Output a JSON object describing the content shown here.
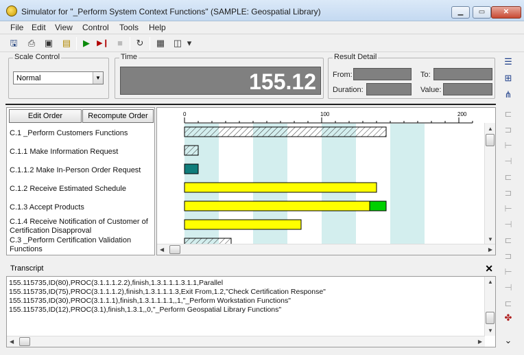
{
  "window": {
    "title": "Simulator for \"_Perform System Context Functions\" (SAMPLE: Geospatial Library)",
    "buttons": {
      "minimize": "▁",
      "maximize": "▭",
      "close": "✕"
    }
  },
  "menu": [
    "File",
    "Edit",
    "View",
    "Control",
    "Tools",
    "Help"
  ],
  "toolbar": {
    "icons": [
      "save-icon",
      "print-icon",
      "print-preview-icon",
      "export-icon",
      "play-icon",
      "step-icon",
      "stop-icon",
      "reset-icon",
      "grid-icon",
      "layout-icon",
      "dropdown-icon"
    ],
    "glyphs": {
      "save": "🖫",
      "print": "⎙",
      "preview": "▣",
      "export": "▤",
      "play": "▶",
      "step": "▶❙",
      "stop": "■",
      "reset": "↻",
      "grid": "▦",
      "layout": "◫",
      "dropdown": "▾"
    }
  },
  "scale_control": {
    "title": "Scale Control",
    "value": "Normal",
    "arrow": "▼"
  },
  "time": {
    "title": "Time",
    "value": "155.12"
  },
  "result_detail": {
    "title": "Result Detail",
    "from_label": "From:",
    "to_label": "To:",
    "duration_label": "Duration:",
    "value_label": "Value:"
  },
  "gantt": {
    "edit_order": "Edit Order",
    "recompute_order": "Recompute Order",
    "tasks": [
      "C.1 _Perform Customers Functions",
      "C.1.1 Make Information Request",
      "C.1.1.2 Make In-Person Order Request",
      "C.1.2 Receive Estimated Schedule",
      "C.1.3 Accept Products",
      "C.1.4 Receive Notification of Customer of Certification Disapproval",
      "C.3 _Perform Certification Validation Functions"
    ],
    "axis": {
      "ticks": [
        0,
        100,
        200
      ],
      "tick_labels": [
        "0",
        "100",
        "200"
      ],
      "range": [
        0,
        200
      ]
    },
    "bars": [
      {
        "task": "C.1",
        "start": 0,
        "end": 147,
        "style": "hatched"
      },
      {
        "task": "C.1.1",
        "start": 0,
        "end": 10,
        "style": "hatched"
      },
      {
        "task": "C.1.1.2",
        "start": 0,
        "end": 10,
        "style": "teal"
      },
      {
        "task": "C.1.2",
        "start": 0,
        "end": 140,
        "style": "yellow"
      },
      {
        "task": "C.1.3",
        "start": 0,
        "end": 135,
        "style": "yellow"
      },
      {
        "task": "C.1.3",
        "start": 135,
        "end": 147,
        "style": "green"
      },
      {
        "task": "C.1.4",
        "start": 0,
        "end": 85,
        "style": "yellow"
      },
      {
        "task": "C.3",
        "start": 0,
        "end": 34,
        "style": "hatched"
      }
    ],
    "shaded_bands": [
      [
        0,
        25
      ],
      [
        50,
        75
      ],
      [
        100,
        125
      ],
      [
        150,
        175
      ]
    ],
    "colors": {
      "yellow": "#ffff00",
      "green": "#00d000",
      "teal": "#0f7d7b",
      "band": "#d3eeee"
    },
    "scroll_arrows": {
      "up": "▲",
      "down": "▼",
      "left": "◀",
      "right": "▶"
    }
  },
  "transcript": {
    "title": "Transcript",
    "close": "✕",
    "lines": [
      "155.115735,ID(80),PROC(3.1.1.1.2.2),finish,1.3.1.1.1.3.1.1,Parallel",
      "155.115735,ID(75),PROC(3.1.1.1.2),finish,1.3.1.1.1.3,Exit From,1.2,\"Check Certification Response\"",
      "155.115735,ID(30),PROC(3.1.1.1),finish,1.3.1.1.1.1,,1,\"_Perform Workstation Functions\"",
      "155.115735,ID(12),PROC(3.1),finish,1.3.1,,0,\"_Perform Geospatial Library Functions\""
    ],
    "scroll_arrows": {
      "up": "▲",
      "down": "▼",
      "left": "◀",
      "right": "▶"
    }
  },
  "sidebar": {
    "icons": [
      "list-view-icon",
      "hierarchy-icon",
      "tree-icon",
      "diagram-1-icon",
      "diagram-2-icon",
      "diagram-3-icon",
      "diagram-4-icon",
      "diagram-5-icon",
      "diagram-6-icon",
      "diagram-7-icon",
      "diagram-8-icon",
      "diagram-9-icon",
      "diagram-10-icon",
      "diagram-11-icon",
      "diagram-12-icon",
      "diagram-13-icon",
      "simulator-icon",
      "more-icon"
    ],
    "glyphs": [
      "☰",
      "⊞",
      "⋔",
      "⊏",
      "⊐",
      "⊢",
      "⊣",
      "⊏",
      "⊐",
      "⊢",
      "⊣",
      "⊏",
      "⊐",
      "⊢",
      "⊣",
      "⊏",
      "✤",
      "⌄"
    ]
  }
}
